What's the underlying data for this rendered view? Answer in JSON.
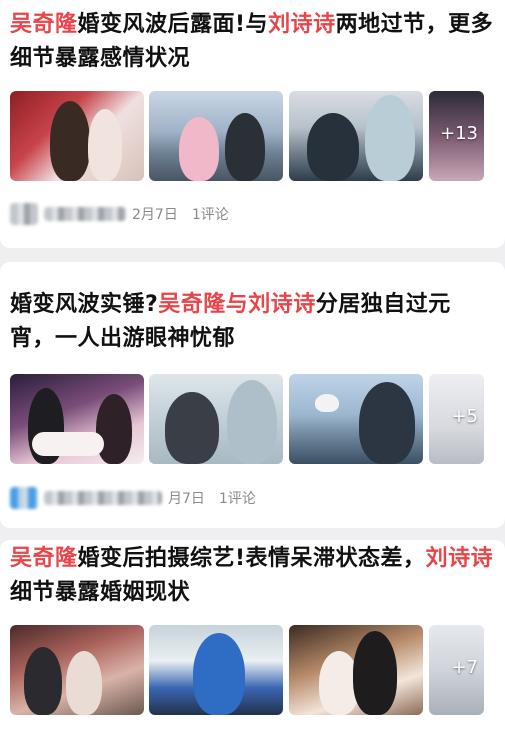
{
  "feed": {
    "items": [
      {
        "title_parts": [
          "吴奇隆",
          "婚变风波后露面!与",
          "刘诗诗",
          "两地过节，更多细节暴露感情状况"
        ],
        "more_count": "+13",
        "date": "2月7日",
        "comments": "1评论"
      },
      {
        "title_parts": [
          "婚变风波实锤?",
          "吴奇隆与刘诗诗",
          "分居独自过元宵，一人出游眼神忧郁"
        ],
        "more_count": "+5",
        "date": "月7日",
        "comments": "1评论"
      },
      {
        "title_parts": [
          "吴奇隆",
          "婚变后拍摄综艺!表情呆滞状态差，",
          "刘诗诗",
          "细节暴露婚姻现状"
        ],
        "more_count": "+7"
      }
    ]
  },
  "colors": {
    "highlight": "#e8454a",
    "title_text": "#111111",
    "meta_text": "#8a8a8a",
    "background": "#efeff1"
  }
}
